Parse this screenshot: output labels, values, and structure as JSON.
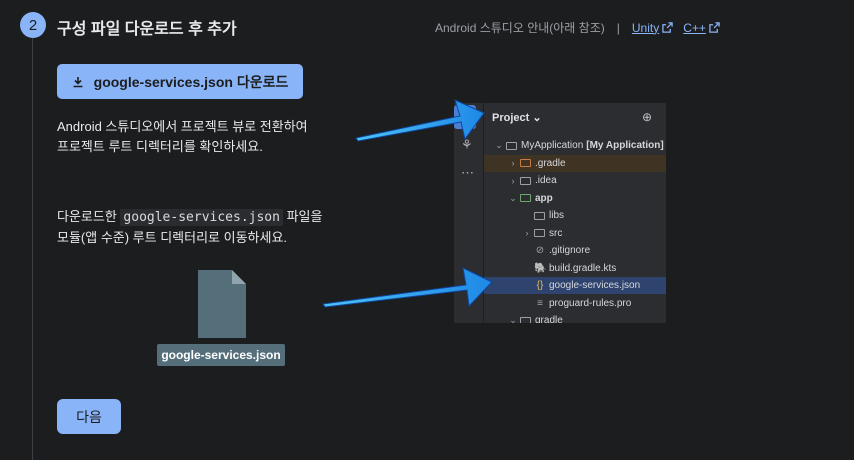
{
  "step": {
    "number": "2",
    "title": "구성 파일 다운로드 후 추가"
  },
  "links": {
    "guide_text": "Android 스튜디오 안내(아래 참조)",
    "separator": "|",
    "unity": "Unity",
    "cpp": "C++"
  },
  "download_button": {
    "label": "google-services.json 다운로드",
    "icon": "download-icon"
  },
  "instructions": {
    "p1_line1": "Android 스튜디오에서 프로젝트 뷰로 전환하여",
    "p1_line2": "프로젝트 루트 디렉터리를 확인하세요.",
    "p2_pre": "다운로드한 ",
    "p2_code": "google-services.json",
    "p2_post": " 파일을",
    "p2_line2": "모듈(앱 수준) 루트 디렉터리로 이동하세요."
  },
  "file_badge": {
    "label": "google-services.json",
    "icon": "file-icon"
  },
  "next_button": {
    "label": "다음"
  },
  "ide": {
    "panel_title": "Project ⌄",
    "tree": [
      {
        "label": "MyApplication",
        "suffix": "[My Application]",
        "indent": 0,
        "chevron": "⌄",
        "icon": "module-folder"
      },
      {
        "label": ".gradle",
        "indent": 1,
        "chevron": "›",
        "icon": "folder-orange"
      },
      {
        "label": ".idea",
        "indent": 1,
        "chevron": "›",
        "icon": "folder"
      },
      {
        "label": "app",
        "indent": 1,
        "chevron": "⌄",
        "icon": "folder-green"
      },
      {
        "label": "libs",
        "indent": 2,
        "chevron": "",
        "icon": "folder"
      },
      {
        "label": "src",
        "indent": 2,
        "chevron": "›",
        "icon": "folder"
      },
      {
        "label": ".gitignore",
        "indent": 2,
        "chevron": "",
        "icon": "gitignore-icon"
      },
      {
        "label": "build.gradle.kts",
        "indent": 2,
        "chevron": "",
        "icon": "gradle-icon"
      },
      {
        "label": "google-services.json",
        "indent": 2,
        "chevron": "",
        "icon": "json-icon"
      },
      {
        "label": "proguard-rules.pro",
        "indent": 2,
        "chevron": "",
        "icon": "text-file-icon"
      },
      {
        "label": "gradle",
        "indent": 1,
        "chevron": "⌄",
        "icon": "folder"
      }
    ]
  },
  "colors": {
    "accent": "#8ab4f8",
    "background": "#1c1d1f",
    "arrow": "#1e88e5",
    "file_badge": "#546e7a"
  }
}
